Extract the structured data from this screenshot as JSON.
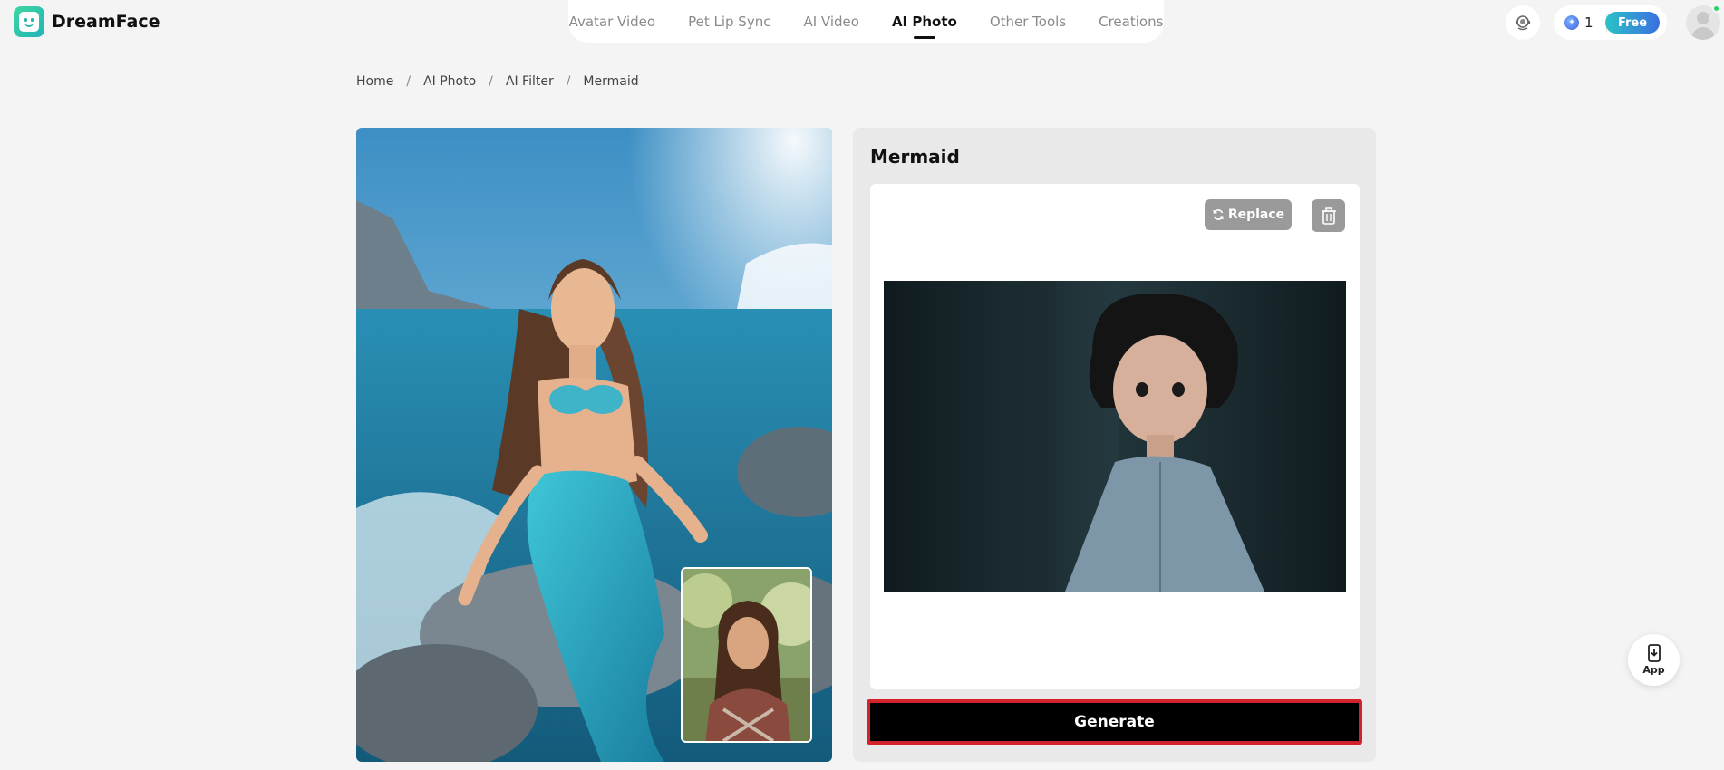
{
  "brand": {
    "name": "DreamFace"
  },
  "nav": {
    "tabs": [
      {
        "label": "Avatar Video",
        "active": false
      },
      {
        "label": "Pet Lip Sync",
        "active": false
      },
      {
        "label": "AI Video",
        "active": false
      },
      {
        "label": "AI Photo",
        "active": true
      },
      {
        "label": "Other Tools",
        "active": false
      },
      {
        "label": "Creations",
        "active": false
      }
    ]
  },
  "header": {
    "credits": "1",
    "plan_badge": "Free"
  },
  "breadcrumb": [
    "Home",
    "AI Photo",
    "AI Filter",
    "Mermaid"
  ],
  "panel": {
    "title": "Mermaid",
    "replace_label": "Replace",
    "generate_label": "Generate"
  },
  "fab": {
    "label": "App"
  },
  "icons": [
    "support-icon",
    "credit-icon",
    "refresh-icon",
    "trash-icon",
    "app-download-icon",
    "avatar-icon"
  ],
  "colors": {
    "accent": "#d2232a",
    "plan_gradient_start": "#2cc2c7",
    "plan_gradient_end": "#3a6fe0"
  }
}
